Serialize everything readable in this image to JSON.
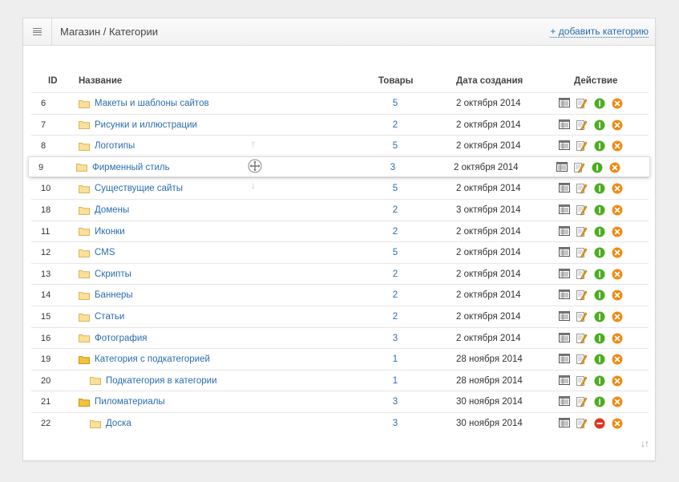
{
  "header": {
    "breadcrumb": "Магазин / Категории",
    "add_link": "+ добавить категорию"
  },
  "columns": {
    "id": "ID",
    "name": "Название",
    "count": "Товары",
    "date": "Дата создания",
    "actions": "Действие"
  },
  "rows": [
    {
      "id": "6",
      "name": "Макеты и шаблоны сайтов",
      "count": "5",
      "date": "2 октября 2014",
      "level": 0,
      "parent": false,
      "status": "active"
    },
    {
      "id": "7",
      "name": "Рисунки и иллюстрации",
      "count": "2",
      "date": "2 октября 2014",
      "level": 0,
      "parent": false,
      "status": "active"
    },
    {
      "id": "8",
      "name": "Логотипы",
      "count": "5",
      "date": "2 октября 2014",
      "level": 0,
      "parent": false,
      "status": "active"
    },
    {
      "id": "9",
      "name": "Фирменный стиль",
      "count": "3",
      "date": "2 октября 2014",
      "level": 0,
      "parent": false,
      "status": "active",
      "dragging": true
    },
    {
      "id": "10",
      "name": "Существущие сайты",
      "count": "5",
      "date": "2 октября 2014",
      "level": 0,
      "parent": false,
      "status": "active"
    },
    {
      "id": "18",
      "name": "Домены",
      "count": "2",
      "date": "3 октября 2014",
      "level": 0,
      "parent": false,
      "status": "active"
    },
    {
      "id": "11",
      "name": "Иконки",
      "count": "2",
      "date": "2 октября 2014",
      "level": 0,
      "parent": false,
      "status": "active"
    },
    {
      "id": "12",
      "name": "CMS",
      "count": "5",
      "date": "2 октября 2014",
      "level": 0,
      "parent": false,
      "status": "active"
    },
    {
      "id": "13",
      "name": "Скрипты",
      "count": "2",
      "date": "2 октября 2014",
      "level": 0,
      "parent": false,
      "status": "active"
    },
    {
      "id": "14",
      "name": "Баннеры",
      "count": "2",
      "date": "2 октября 2014",
      "level": 0,
      "parent": false,
      "status": "active"
    },
    {
      "id": "15",
      "name": "Статьи",
      "count": "2",
      "date": "2 октября 2014",
      "level": 0,
      "parent": false,
      "status": "active"
    },
    {
      "id": "16",
      "name": "Фотография",
      "count": "3",
      "date": "2 октября 2014",
      "level": 0,
      "parent": false,
      "status": "active"
    },
    {
      "id": "19",
      "name": "Категория с подкатегорией",
      "count": "1",
      "date": "28 ноября 2014",
      "level": 0,
      "parent": true,
      "status": "active"
    },
    {
      "id": "20",
      "name": "Подкатегория в категории",
      "count": "1",
      "date": "28 ноября 2014",
      "level": 1,
      "parent": false,
      "status": "active"
    },
    {
      "id": "21",
      "name": "Пиломатериалы",
      "count": "3",
      "date": "30 ноября 2014",
      "level": 0,
      "parent": true,
      "status": "active"
    },
    {
      "id": "22",
      "name": "Доска",
      "count": "3",
      "date": "30 ноября 2014",
      "level": 1,
      "parent": false,
      "status": "disabled"
    }
  ],
  "colors": {
    "link": "#2a6db0",
    "active": "#4cae1e",
    "disabled": "#d9381e",
    "delete": "#f08a14"
  }
}
